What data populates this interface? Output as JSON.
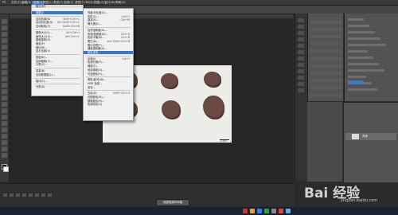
{
  "menubar": {
    "items": [
      "PS",
      "文件(F)",
      "编辑(E)",
      "图像(I)",
      "图层(L)",
      "类型(Y)",
      "选择(S)",
      "滤镜(T)",
      "3D(D)",
      "视图(V)",
      "窗口(W)",
      "帮助(H)"
    ]
  },
  "image_menu": {
    "header": "模式(M)",
    "items": [
      {
        "label": "调整(J)",
        "shortcut": "",
        "highlight": true
      },
      {
        "sep": true
      },
      {
        "label": "自动色调(N)",
        "shortcut": "Shift+Ctrl+L"
      },
      {
        "label": "自动对比度(U)",
        "shortcut": "Alt+Shift+Ctrl+L"
      },
      {
        "label": "自动颜色(O)",
        "shortcut": "Shift+Ctrl+B"
      },
      {
        "sep": true
      },
      {
        "label": "图像大小(I)...",
        "shortcut": "Alt+Ctrl+I"
      },
      {
        "label": "画布大小(S)...",
        "shortcut": "Alt+Ctrl+C"
      },
      {
        "label": "图像旋转(G)",
        "shortcut": ""
      },
      {
        "label": "裁剪(P)",
        "shortcut": ""
      },
      {
        "label": "裁切(R)...",
        "shortcut": ""
      },
      {
        "label": "显示全部(V)",
        "shortcut": ""
      },
      {
        "sep": true
      },
      {
        "label": "复制(D)...",
        "shortcut": ""
      },
      {
        "label": "应用图像(Y)...",
        "shortcut": ""
      },
      {
        "label": "计算(C)...",
        "shortcut": ""
      },
      {
        "sep": true
      },
      {
        "label": "变量(B)",
        "shortcut": ""
      },
      {
        "label": "应用数据组(L)...",
        "shortcut": ""
      },
      {
        "sep": true
      },
      {
        "label": "陷印(T)...",
        "shortcut": ""
      },
      {
        "sep": true
      },
      {
        "label": "分析(A)",
        "shortcut": ""
      }
    ]
  },
  "adjust_menu": {
    "items": [
      {
        "label": "亮度/对比度(C)...",
        "shortcut": ""
      },
      {
        "label": "色阶(L)...",
        "shortcut": "Ctrl+L"
      },
      {
        "label": "曲线(U)...",
        "shortcut": "Ctrl+M"
      },
      {
        "label": "曝光度(E)...",
        "shortcut": ""
      },
      {
        "sep": true
      },
      {
        "label": "自然饱和度(V)...",
        "shortcut": ""
      },
      {
        "label": "色相/饱和度(H)...",
        "shortcut": "Ctrl+U"
      },
      {
        "label": "色彩平衡(B)...",
        "shortcut": "Ctrl+B"
      },
      {
        "label": "黑白(K)...",
        "shortcut": "Alt+Shift+Ctrl+B"
      },
      {
        "label": "照片滤镜(F)...",
        "shortcut": ""
      },
      {
        "label": "通道混和器(X)...",
        "shortcut": ""
      },
      {
        "label": "颜色查找...",
        "shortcut": ""
      },
      {
        "sep": true
      },
      {
        "label": "反相(I)",
        "shortcut": "Ctrl+I"
      },
      {
        "label": "色调分离(P)...",
        "shortcut": ""
      },
      {
        "label": "阈值(T)...",
        "shortcut": ""
      },
      {
        "label": "渐变映射(G)...",
        "shortcut": ""
      },
      {
        "label": "可选颜色(S)...",
        "shortcut": ""
      },
      {
        "sep": true
      },
      {
        "label": "阴影/高光(W)...",
        "shortcut": ""
      },
      {
        "label": "HDR 色调...",
        "shortcut": ""
      },
      {
        "label": "变化...",
        "shortcut": ""
      },
      {
        "sep": true
      },
      {
        "label": "去色(D)",
        "shortcut": "Shift+Ctrl+U"
      },
      {
        "label": "匹配颜色(M)...",
        "shortcut": ""
      },
      {
        "label": "替换颜色(R)...",
        "shortcut": ""
      },
      {
        "label": "色调均化(Q)",
        "shortcut": ""
      }
    ]
  },
  "timeline": {
    "button_label": "创建视频时间轴"
  },
  "photo": {
    "scale_label": "2 cm"
  },
  "watermark": {
    "text": "Bai 经验",
    "url": "jingyan.baidu.com"
  },
  "layers_panel": {
    "layer_name": "背景"
  },
  "colors": {
    "highlight": "#3478d0",
    "menu_bg": "#f0f0f0",
    "ui_dark": "#2b2b2b"
  }
}
